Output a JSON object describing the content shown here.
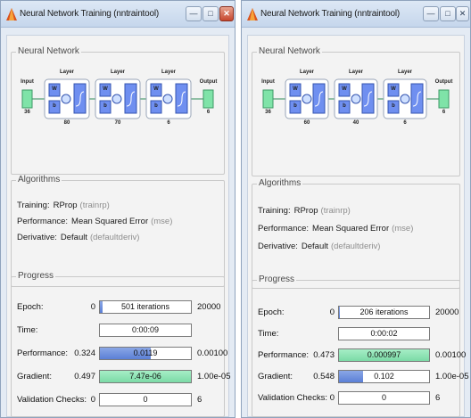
{
  "windows": [
    {
      "title": "Neural Network Training (nntraintool)",
      "network": {
        "section_title": "Neural Network",
        "input_label": "Input",
        "input_size": "36",
        "output_label": "Output",
        "output_size": "6",
        "layer_label": "Layer",
        "w_label": "W",
        "b_label": "b",
        "layer_sizes": [
          "80",
          "70",
          "6"
        ]
      },
      "algorithms": {
        "section_title": "Algorithms",
        "training_label": "Training:",
        "training_value": "RProp",
        "training_hint": "(trainrp)",
        "performance_label": "Performance:",
        "performance_value": "Mean Squared Error",
        "performance_hint": "(mse)",
        "derivative_label": "Derivative:",
        "derivative_value": "Default",
        "derivative_hint": "(defaultderiv)"
      },
      "progress": {
        "section_title": "Progress",
        "rows": [
          {
            "label": "Epoch:",
            "start": "0",
            "current": "501 iterations",
            "end": "20000",
            "fill": 0.025,
            "color": "blue"
          },
          {
            "label": "Time:",
            "start": "",
            "current": "0:00:09",
            "end": "",
            "fill": 0,
            "color": "none"
          },
          {
            "label": "Performance:",
            "start": "0.324",
            "current": "0.0119",
            "end": "0.00100",
            "fill": 0.56,
            "color": "blue"
          },
          {
            "label": "Gradient:",
            "start": "0.497",
            "current": "7.47e-06",
            "end": "1.00e-05",
            "fill": 1.0,
            "color": "green"
          },
          {
            "label": "Validation Checks:",
            "start": "0",
            "current": "0",
            "end": "6",
            "fill": 0,
            "color": "none"
          }
        ]
      }
    },
    {
      "title": "Neural Network Training (nntraintool)",
      "network": {
        "section_title": "Neural Network",
        "input_label": "Input",
        "input_size": "36",
        "output_label": "Output",
        "output_size": "6",
        "layer_label": "Layer",
        "w_label": "W",
        "b_label": "b",
        "layer_sizes": [
          "60",
          "40",
          "6"
        ]
      },
      "algorithms": {
        "section_title": "Algorithms",
        "training_label": "Training:",
        "training_value": "RProp",
        "training_hint": "(trainrp)",
        "performance_label": "Performance:",
        "performance_value": "Mean Squared Error",
        "performance_hint": "(mse)",
        "derivative_label": "Derivative:",
        "derivative_value": "Default",
        "derivative_hint": "(defaultderiv)"
      },
      "progress": {
        "section_title": "Progress",
        "rows": [
          {
            "label": "Epoch:",
            "start": "0",
            "current": "206 iterations",
            "end": "20000",
            "fill": 0.01,
            "color": "blue"
          },
          {
            "label": "Time:",
            "start": "",
            "current": "0:00:02",
            "end": "",
            "fill": 0,
            "color": "none"
          },
          {
            "label": "Performance:",
            "start": "0.473",
            "current": "0.000997",
            "end": "0.00100",
            "fill": 1.0,
            "color": "green"
          },
          {
            "label": "Gradient:",
            "start": "0.548",
            "current": "0.102",
            "end": "1.00e-05",
            "fill": 0.27,
            "color": "blue"
          },
          {
            "label": "Validation Checks:",
            "start": "0",
            "current": "0",
            "end": "6",
            "fill": 0,
            "color": "none"
          }
        ]
      }
    }
  ],
  "icons": {
    "app": "matlab-logo-icon",
    "minimize": "minimize-icon",
    "maximize": "maximize-icon",
    "close": "close-icon"
  },
  "colors": {
    "input_node": "#7fe3a8",
    "layer_box": "#6f8ff0",
    "layer_frame": "#ffffff",
    "fill_blue": "#6f8fe0",
    "fill_green": "#8fe6b6"
  }
}
